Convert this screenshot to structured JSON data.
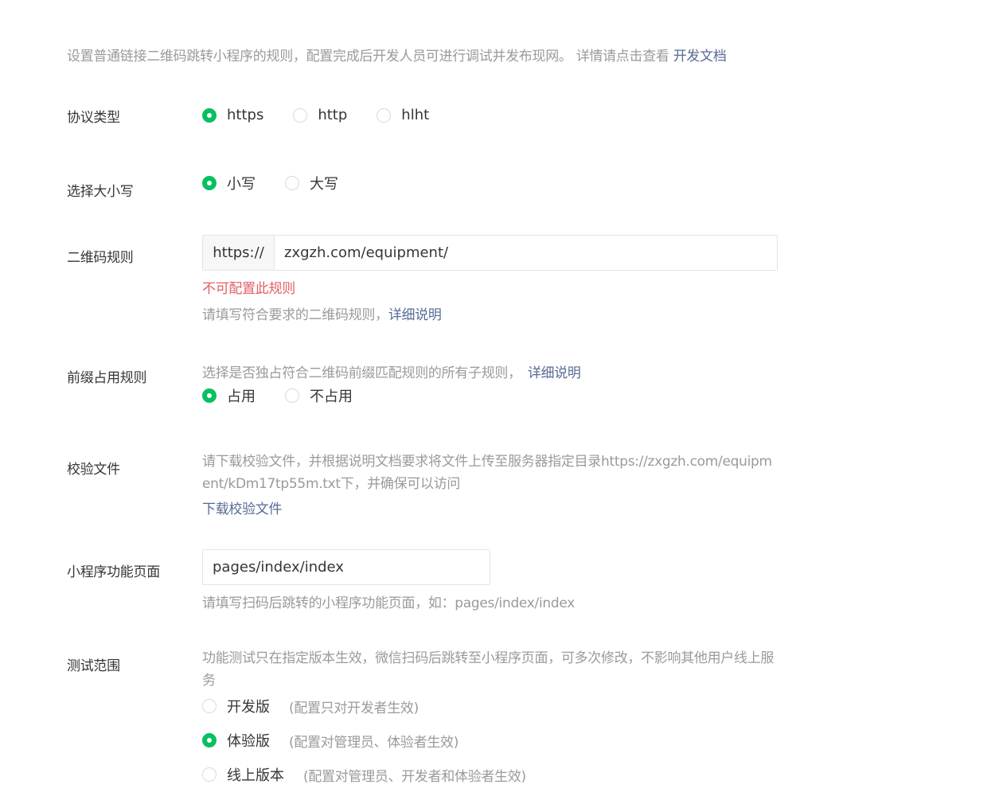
{
  "intro": {
    "text": "设置普通链接二维码跳转小程序的规则，配置完成后开发人员可进行调试并发布现网。 详情请点击查看 ",
    "link": "开发文档"
  },
  "protocol": {
    "label": "协议类型",
    "options": [
      "https",
      "http",
      "hlht"
    ],
    "selected": "https"
  },
  "case": {
    "label": "选择大小写",
    "options": [
      "小写",
      "大写"
    ],
    "selected": "小写"
  },
  "qr_rule": {
    "label": "二维码规则",
    "prefix": "https://",
    "value": "zxgzh.com/equipment/",
    "error": "不可配置此规则",
    "hint": "请填写符合要求的二维码规则，",
    "hint_link": "详细说明"
  },
  "prefix_rule": {
    "label": "前缀占用规则",
    "hint": "选择是否独占符合二维码前缀匹配规则的所有子规则，",
    "hint_link": "详细说明",
    "options": [
      "占用",
      "不占用"
    ],
    "selected": "占用"
  },
  "verify_file": {
    "label": "校验文件",
    "text": "请下载校验文件，并根据说明文档要求将文件上传至服务器指定目录https://zxgzh.com/equipment/kDm17tp55m.txt下，并确保可以访问",
    "download_link": "下载校验文件"
  },
  "mp_page": {
    "label": "小程序功能页面",
    "value": "pages/index/index",
    "hint": "请填写扫码后跳转的小程序功能页面，如：pages/index/index"
  },
  "test_scope": {
    "label": "测试范围",
    "desc": "功能测试只在指定版本生效，微信扫码后跳转至小程序页面，可多次修改，不影响其他用户线上服务",
    "options": [
      {
        "label": "开发版",
        "desc": "(配置只对开发者生效)"
      },
      {
        "label": "体验版",
        "desc": "(配置对管理员、体验者生效)"
      },
      {
        "label": "线上版本",
        "desc": "(配置对管理员、开发者和体验者生效)"
      }
    ],
    "selected": "体验版"
  },
  "colors": {
    "accent": "#07c160",
    "link": "#576b95",
    "error": "#e15f63",
    "hint": "#9a9a9a",
    "text": "#353535"
  }
}
